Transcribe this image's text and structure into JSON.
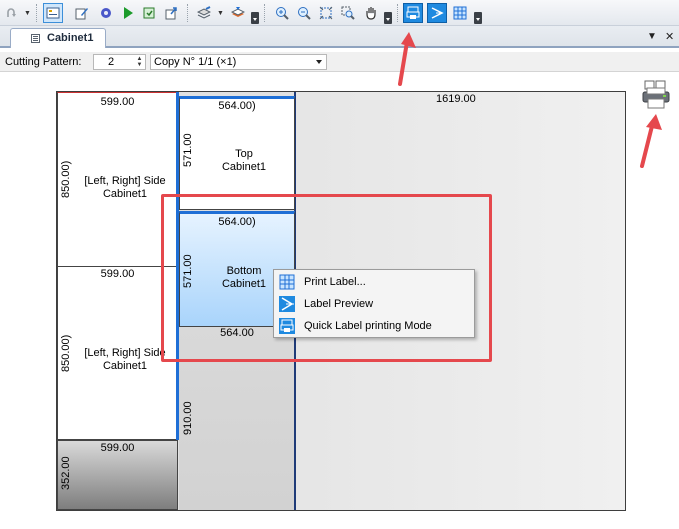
{
  "toolbar": {
    "icons": [
      "redo-icon",
      "toolbar-options-icon",
      "properties-icon",
      "edit-icon",
      "settings-icon",
      "run-icon",
      "export-icon",
      "import-icon",
      "layers-icon",
      "stack-icon",
      "zoom-in-icon",
      "zoom-out-icon",
      "zoom-fit-icon",
      "zoom-window-icon",
      "pan-icon",
      "quick-label-icon",
      "label-preview-icon",
      "print-label-icon"
    ]
  },
  "tabs": {
    "active_label": "Cabinet1",
    "dropdown_glyph": "▼",
    "close_glyph": "✕"
  },
  "pattern_bar": {
    "cutting_pattern_label": "Cutting Pattern:",
    "pattern_number": "2",
    "copy_value": "Copy N° 1/1 (×1)"
  },
  "sheet": {
    "top_width_label": "1619.00",
    "parts": [
      {
        "width": "599.00",
        "height": "850.00)",
        "name_line1": "[Left, Right] Side",
        "name_line2": "Cabinet1"
      },
      {
        "width": "599.00",
        "height": "850.00)",
        "name_line1": "[Left, Right] Side",
        "name_line2": "Cabinet1"
      },
      {
        "width": "564.00)",
        "height": "571.00",
        "name_line1": "Top",
        "name_line2": "Cabinet1"
      },
      {
        "width": "564.00)",
        "height": "571.00",
        "name_line1": "Bottom",
        "name_line2": "Cabinet1"
      }
    ],
    "waste_bottom_left": {
      "width": "599.00",
      "height": "352.00"
    },
    "waste_middle": {
      "width": "564.00",
      "height": "910.00"
    }
  },
  "context_menu": {
    "items": [
      {
        "label": "Print Label...",
        "icon": "print-label-icon"
      },
      {
        "label": "Label Preview",
        "icon": "label-preview-icon"
      },
      {
        "label": "Quick Label printing Mode",
        "icon": "quick-label-icon"
      }
    ]
  },
  "colors": {
    "highlight_box": "#e5484d",
    "arrow": "#e5484d",
    "selected_part": "#bfe0ff",
    "accent_blue": "#1f8ae0"
  }
}
